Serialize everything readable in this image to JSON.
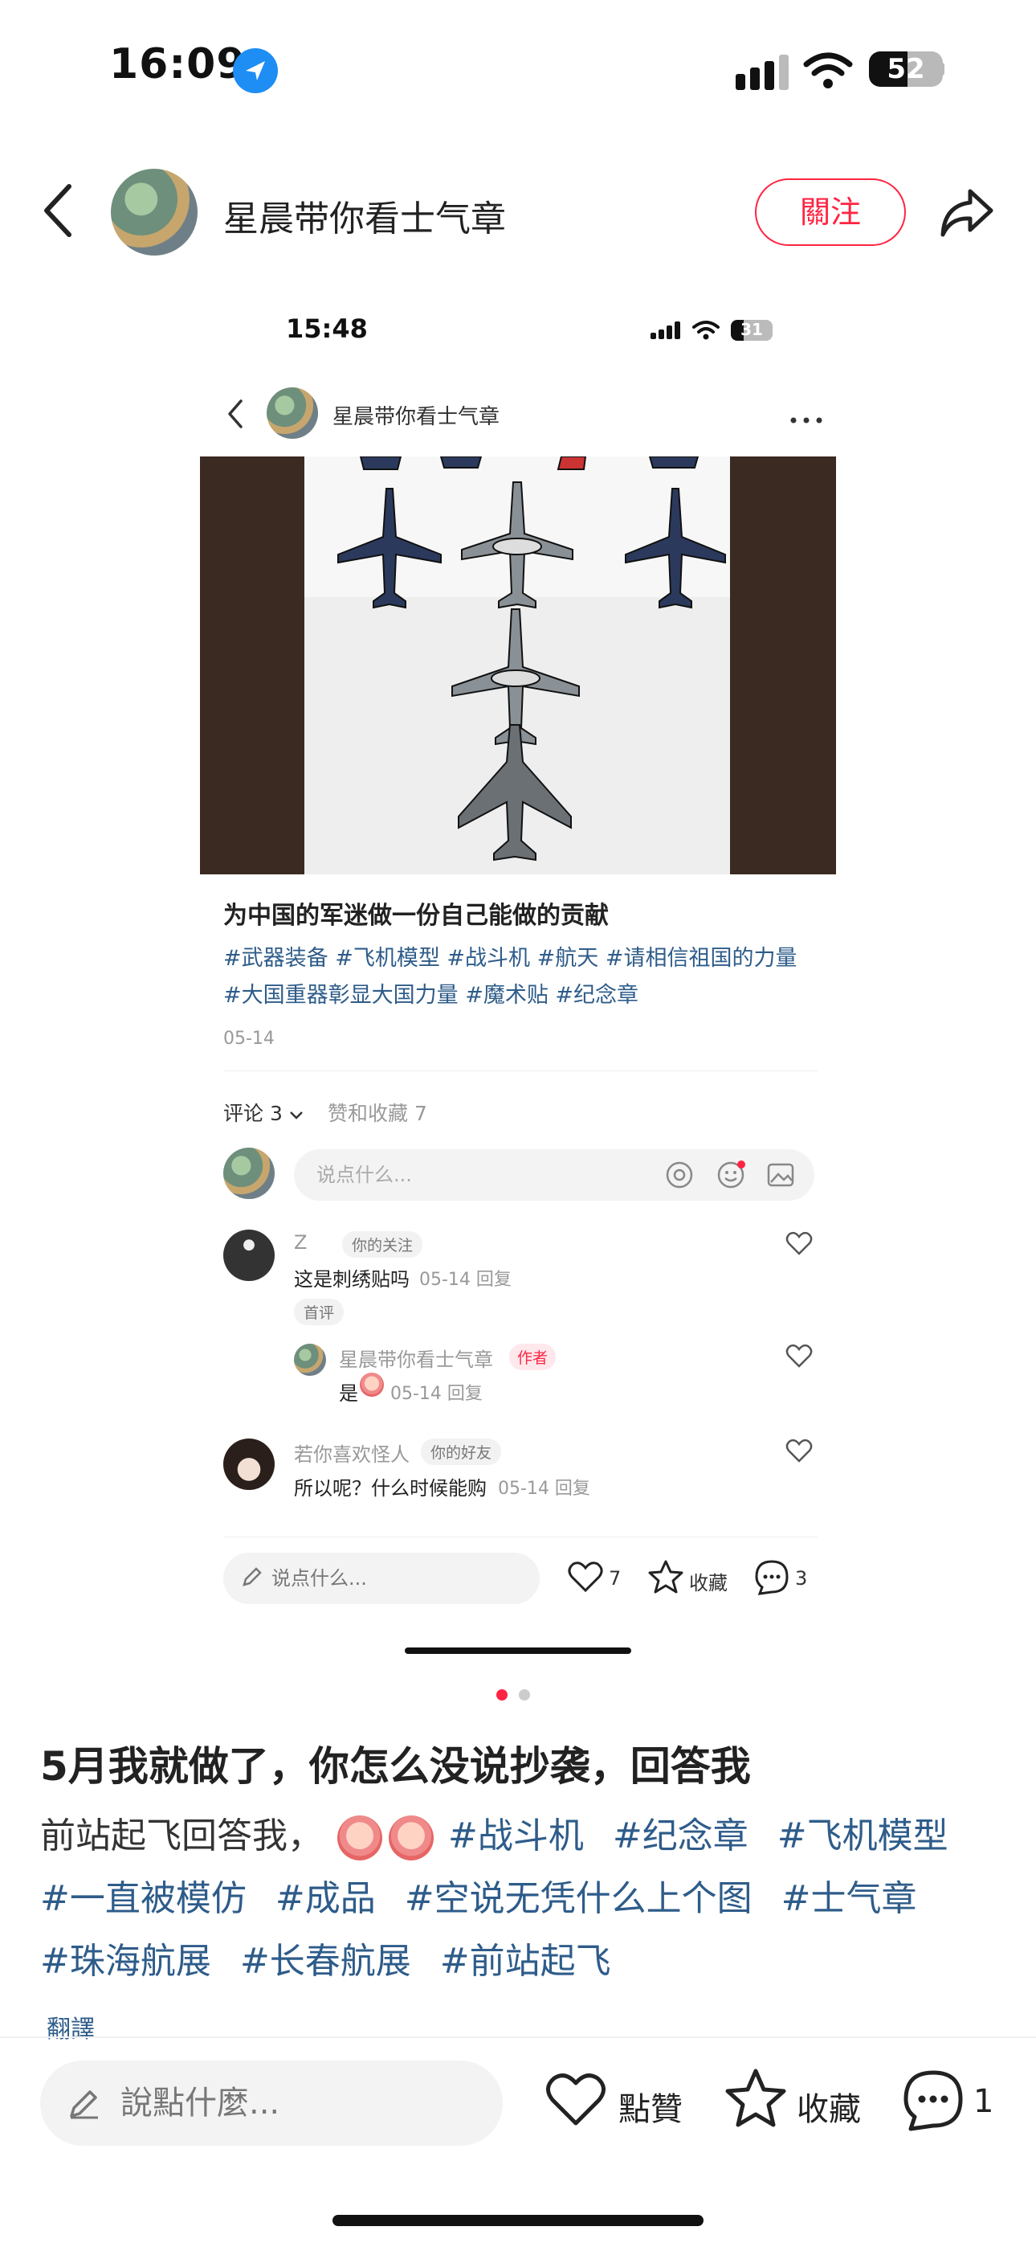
{
  "status_bar": {
    "time": "16:09",
    "battery": "52"
  },
  "header": {
    "author": "星晨带你看士气章",
    "follow_label": "關注"
  },
  "inner": {
    "time": "15:48",
    "battery": "31",
    "author": "星晨带你看士气章",
    "title": "为中国的军迷做一份自己能做的贡献",
    "tags_line1": "#武器装备 #飞机模型 #战斗机 #航天 #请相信祖国的力量",
    "tags_line2": "#大国重器彰显大国力量 #魔术贴 #纪念章",
    "date": "05-14",
    "tab_comments": "评论 3",
    "tab_likes": "赞和收藏 7",
    "input_placeholder": "说点什么...",
    "comments": [
      {
        "name": "Z",
        "badge": "你的关注",
        "text": "这是刺绣贴吗",
        "meta": "05-14 回复",
        "tag": "首评"
      },
      {
        "name": "星晨带你看士气章",
        "badge": "作者",
        "text": "是",
        "meta": "05-14 回复"
      },
      {
        "name": "若你喜欢怪人",
        "badge": "你的好友",
        "text": "所以呢？什么时候能购",
        "meta": "05-14 回复"
      }
    ],
    "bar_input": "说点什么...",
    "likes": "7",
    "collect_label": "收藏",
    "comments_count": "3"
  },
  "post": {
    "title": "5月我就做了，你怎么没说抄袭，回答我",
    "text_prefix": "前站起飞回答我，",
    "tags": [
      "#战斗机",
      "#纪念章",
      "#飞机模型",
      "#一直被模仿",
      "#成品",
      "#空说无凭什么上个图",
      "#士气章",
      "#珠海航展",
      "#长春航展",
      "#前站起飞"
    ],
    "translate": "翻譯"
  },
  "bottom_bar": {
    "input_placeholder": "說點什麼...",
    "like_label": "點贊",
    "collect_label": "收藏",
    "comment_count": "1"
  },
  "colors": {
    "accent": "#ff2442",
    "tag": "#2e5c8a",
    "location": "#1e8ef5"
  }
}
